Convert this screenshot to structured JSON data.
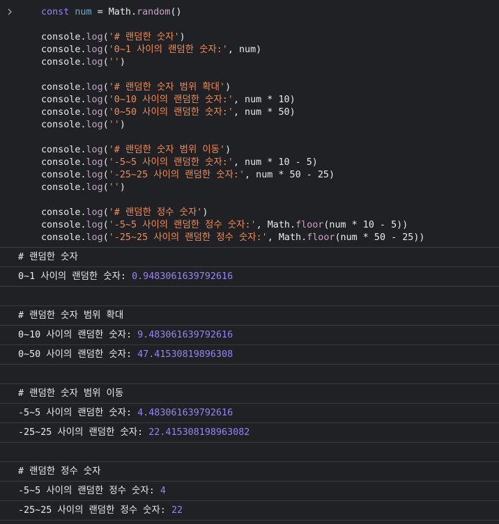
{
  "code_lines": [
    [
      {
        "t": "const",
        "c": "kw"
      },
      {
        "t": " ",
        "c": "plain"
      },
      {
        "t": "num",
        "c": "var"
      },
      {
        "t": " = ",
        "c": "plain"
      },
      {
        "t": "Math",
        "c": "obj"
      },
      {
        "t": ".",
        "c": "plain"
      },
      {
        "t": "random",
        "c": "fn"
      },
      {
        "t": "()",
        "c": "plain"
      }
    ],
    [],
    [
      {
        "t": "console",
        "c": "obj"
      },
      {
        "t": ".",
        "c": "plain"
      },
      {
        "t": "log",
        "c": "fn"
      },
      {
        "t": "(",
        "c": "plain"
      },
      {
        "t": "'# 랜덤한 숫자'",
        "c": "str"
      },
      {
        "t": ")",
        "c": "plain"
      }
    ],
    [
      {
        "t": "console",
        "c": "obj"
      },
      {
        "t": ".",
        "c": "plain"
      },
      {
        "t": "log",
        "c": "fn"
      },
      {
        "t": "(",
        "c": "plain"
      },
      {
        "t": "'0~1 사이의 랜덤한 숫자:'",
        "c": "str"
      },
      {
        "t": ", num)",
        "c": "plain"
      }
    ],
    [
      {
        "t": "console",
        "c": "obj"
      },
      {
        "t": ".",
        "c": "plain"
      },
      {
        "t": "log",
        "c": "fn"
      },
      {
        "t": "(",
        "c": "plain"
      },
      {
        "t": "''",
        "c": "str"
      },
      {
        "t": ")",
        "c": "plain"
      }
    ],
    [],
    [
      {
        "t": "console",
        "c": "obj"
      },
      {
        "t": ".",
        "c": "plain"
      },
      {
        "t": "log",
        "c": "fn"
      },
      {
        "t": "(",
        "c": "plain"
      },
      {
        "t": "'# 랜덤한 숫자 범위 확대'",
        "c": "str"
      },
      {
        "t": ")",
        "c": "plain"
      }
    ],
    [
      {
        "t": "console",
        "c": "obj"
      },
      {
        "t": ".",
        "c": "plain"
      },
      {
        "t": "log",
        "c": "fn"
      },
      {
        "t": "(",
        "c": "plain"
      },
      {
        "t": "'0~10 사이의 랜덤한 숫자:'",
        "c": "str"
      },
      {
        "t": ", num * ",
        "c": "plain"
      },
      {
        "t": "10",
        "c": "plain"
      },
      {
        "t": ")",
        "c": "plain"
      }
    ],
    [
      {
        "t": "console",
        "c": "obj"
      },
      {
        "t": ".",
        "c": "plain"
      },
      {
        "t": "log",
        "c": "fn"
      },
      {
        "t": "(",
        "c": "plain"
      },
      {
        "t": "'0~50 사이의 랜덤한 숫자:'",
        "c": "str"
      },
      {
        "t": ", num * ",
        "c": "plain"
      },
      {
        "t": "50",
        "c": "plain"
      },
      {
        "t": ")",
        "c": "plain"
      }
    ],
    [
      {
        "t": "console",
        "c": "obj"
      },
      {
        "t": ".",
        "c": "plain"
      },
      {
        "t": "log",
        "c": "fn"
      },
      {
        "t": "(",
        "c": "plain"
      },
      {
        "t": "''",
        "c": "str"
      },
      {
        "t": ")",
        "c": "plain"
      }
    ],
    [],
    [
      {
        "t": "console",
        "c": "obj"
      },
      {
        "t": ".",
        "c": "plain"
      },
      {
        "t": "log",
        "c": "fn"
      },
      {
        "t": "(",
        "c": "plain"
      },
      {
        "t": "'# 랜덤한 숫자 범위 이동'",
        "c": "str"
      },
      {
        "t": ")",
        "c": "plain"
      }
    ],
    [
      {
        "t": "console",
        "c": "obj"
      },
      {
        "t": ".",
        "c": "plain"
      },
      {
        "t": "log",
        "c": "fn"
      },
      {
        "t": "(",
        "c": "plain"
      },
      {
        "t": "'-5~5 사이의 랜덤한 숫자:'",
        "c": "str"
      },
      {
        "t": ", num * 10 - 5)",
        "c": "plain"
      }
    ],
    [
      {
        "t": "console",
        "c": "obj"
      },
      {
        "t": ".",
        "c": "plain"
      },
      {
        "t": "log",
        "c": "fn"
      },
      {
        "t": "(",
        "c": "plain"
      },
      {
        "t": "'-25~25 사이의 랜덤한 숫자:'",
        "c": "str"
      },
      {
        "t": ", num * 50 - 25)",
        "c": "plain"
      }
    ],
    [
      {
        "t": "console",
        "c": "obj"
      },
      {
        "t": ".",
        "c": "plain"
      },
      {
        "t": "log",
        "c": "fn"
      },
      {
        "t": "(",
        "c": "plain"
      },
      {
        "t": "''",
        "c": "str"
      },
      {
        "t": ")",
        "c": "plain"
      }
    ],
    [],
    [
      {
        "t": "console",
        "c": "obj"
      },
      {
        "t": ".",
        "c": "plain"
      },
      {
        "t": "log",
        "c": "fn"
      },
      {
        "t": "(",
        "c": "plain"
      },
      {
        "t": "'# 랜덤한 정수 숫자'",
        "c": "str"
      },
      {
        "t": ")",
        "c": "plain"
      }
    ],
    [
      {
        "t": "console",
        "c": "obj"
      },
      {
        "t": ".",
        "c": "plain"
      },
      {
        "t": "log",
        "c": "fn"
      },
      {
        "t": "(",
        "c": "plain"
      },
      {
        "t": "'-5~5 사이의 랜덤한 정수 숫자:'",
        "c": "str"
      },
      {
        "t": ", ",
        "c": "plain"
      },
      {
        "t": "Math",
        "c": "obj"
      },
      {
        "t": ".",
        "c": "plain"
      },
      {
        "t": "floor",
        "c": "fn"
      },
      {
        "t": "(num * 10 - 5))",
        "c": "plain"
      }
    ],
    [
      {
        "t": "console",
        "c": "obj"
      },
      {
        "t": ".",
        "c": "plain"
      },
      {
        "t": "log",
        "c": "fn"
      },
      {
        "t": "(",
        "c": "plain"
      },
      {
        "t": "'-25~25 사이의 랜덤한 정수 숫자:'",
        "c": "str"
      },
      {
        "t": ", ",
        "c": "plain"
      },
      {
        "t": "Math",
        "c": "obj"
      },
      {
        "t": ".",
        "c": "plain"
      },
      {
        "t": "floor",
        "c": "fn"
      },
      {
        "t": "(num * 50 - 25))",
        "c": "plain"
      }
    ]
  ],
  "output_rows": [
    {
      "text": "# 랜덤한 숫자",
      "value": ""
    },
    {
      "text": "0~1 사이의 랜덤한 숫자: ",
      "value": "0.9483061639792616"
    },
    {
      "text": "",
      "value": ""
    },
    {
      "text": "# 랜덤한 숫자 범위 확대",
      "value": ""
    },
    {
      "text": "0~10 사이의 랜덤한 숫자: ",
      "value": "9.483061639792616"
    },
    {
      "text": "0~50 사이의 랜덤한 숫자: ",
      "value": "47.41530819896308"
    },
    {
      "text": "",
      "value": ""
    },
    {
      "text": "# 랜덤한 숫자 범위 이동",
      "value": ""
    },
    {
      "text": "-5~5 사이의 랜덤한 숫자: ",
      "value": "4.483061639792616"
    },
    {
      "text": "-25~25 사이의 랜덤한 숫자: ",
      "value": "22.415308198963082"
    },
    {
      "text": "",
      "value": ""
    },
    {
      "text": "# 랜덤한 정수 숫자",
      "value": ""
    },
    {
      "text": "-5~5 사이의 랜덤한 정수 숫자: ",
      "value": "4"
    },
    {
      "text": "-25~25 사이의 랜덤한 정수 숫자: ",
      "value": "22"
    }
  ],
  "prompt_icon": "chevron-right-icon",
  "colors": {
    "background": "#202124",
    "keyword": "#9980ff",
    "variable": "#5db0d7",
    "string": "#f28b54",
    "number_output": "#9980ff",
    "divider": "#3c3c3c"
  }
}
